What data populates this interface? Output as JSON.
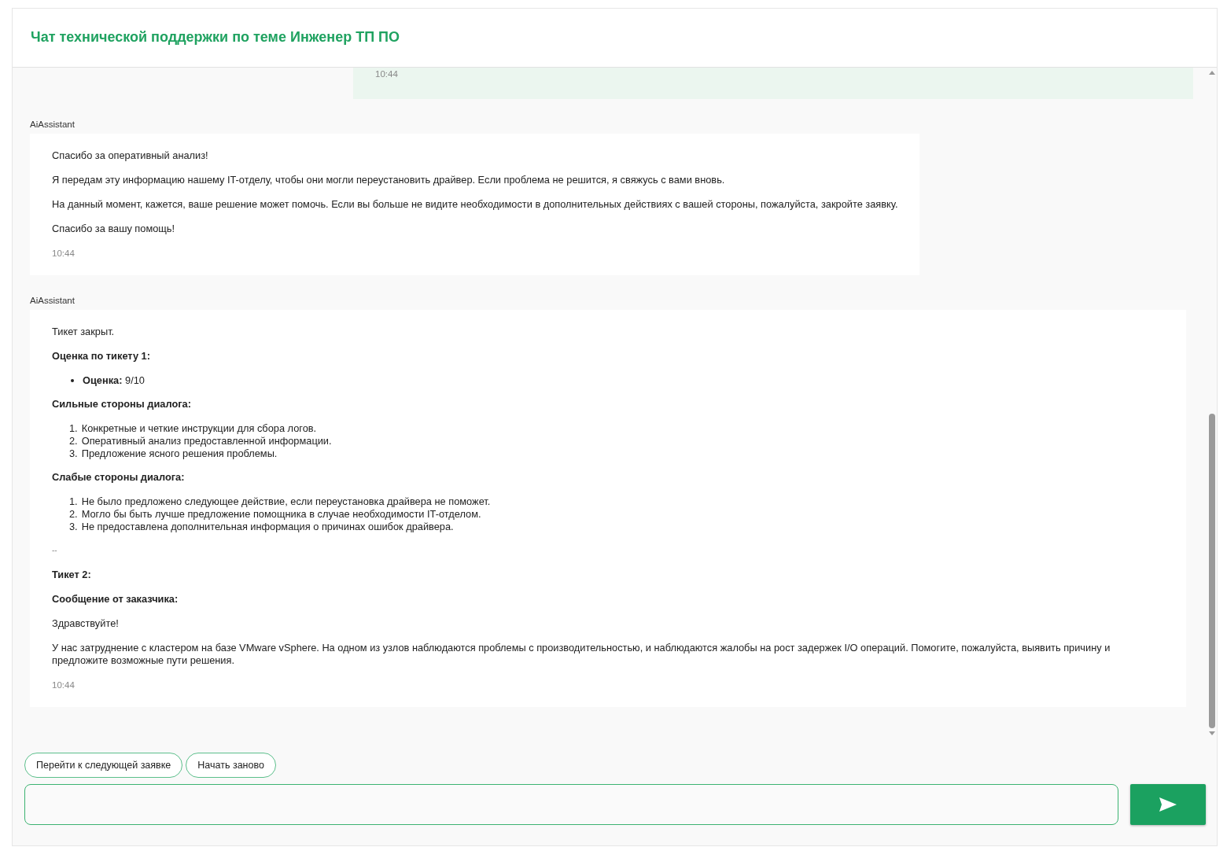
{
  "header": {
    "title": "Чат технической поддержки по теме Инженер ТП ПО"
  },
  "messages": [
    {
      "kind": "user",
      "time": "10:44"
    },
    {
      "kind": "assistant",
      "author": "AiAssistant",
      "time": "10:44",
      "blocks": [
        {
          "kind": "p",
          "text": "Спасибо за оперативный анализ!"
        },
        {
          "kind": "p",
          "text": "Я передам эту информацию нашему IT-отделу, чтобы они могли переустановить драйвер. Если проблема не решится, я свяжусь с вами вновь."
        },
        {
          "kind": "p",
          "text": "На данный момент, кажется, ваше решение может помочь. Если вы больше не видите необходимости в дополнительных действиях с вашей стороны, пожалуйста, закройте заявку."
        },
        {
          "kind": "p",
          "text": "Спасибо за вашу помощь!"
        }
      ]
    },
    {
      "kind": "assistant",
      "author": "AiAssistant",
      "time": "10:44",
      "blocks": [
        {
          "kind": "p",
          "text": "Тикет закрыт."
        },
        {
          "kind": "h",
          "text": "Оценка по тикету 1:"
        },
        {
          "kind": "ul",
          "items": [
            "**Оценка:** 9/10"
          ]
        },
        {
          "kind": "h",
          "text": "Сильные стороны диалога:"
        },
        {
          "kind": "ol",
          "items": [
            {
              "num": "1.",
              "text": "Конкретные и четкие инструкции для сбора логов."
            },
            {
              "num": "2.",
              "text": "Оперативный анализ предоставленной информации."
            },
            {
              "num": "3.",
              "text": "Предложение ясного решения проблемы."
            }
          ]
        },
        {
          "kind": "h",
          "text": "Слабые стороны диалога:"
        },
        {
          "kind": "ol",
          "items": [
            {
              "num": "1.",
              "text": "Не было предложено следующее действие, если переустановка драйвера не поможет."
            },
            {
              "num": "2.",
              "text": "Могло бы быть лучше предложение помощника в случае необходимости IT-отделом."
            },
            {
              "num": "3.",
              "text": "Не предоставлена дополнительная информация о причинах ошибок драйвера."
            }
          ]
        },
        {
          "kind": "sep",
          "text": "--"
        },
        {
          "kind": "h",
          "text": "Тикет 2:"
        },
        {
          "kind": "h",
          "text": "Сообщение от заказчика:"
        },
        {
          "kind": "p",
          "text": "Здравствуйте!"
        },
        {
          "kind": "p",
          "text": "У нас затруднение с кластером на базе VMware vSphere. На одном из узлов наблюдаются проблемы с производительностью, и наблюдаются жалобы на рост задержек I/O операций. Помогите, пожалуйста, выявить причину и предложите возможные пути решения."
        }
      ]
    }
  ],
  "quick_replies": [
    "Перейти к следующей заявке",
    "Начать заново"
  ]
}
